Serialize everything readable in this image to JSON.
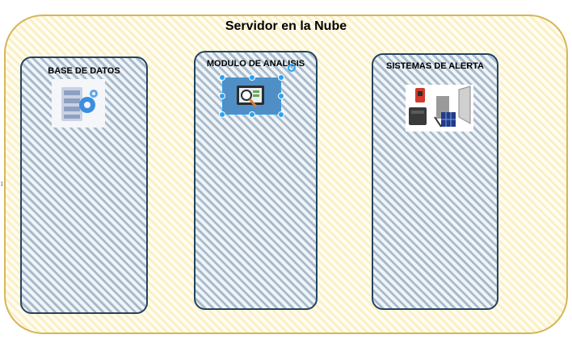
{
  "diagram": {
    "title": "Servidor en la Nube",
    "boxes": [
      {
        "id": "db",
        "label": "BASE DE DATOS",
        "icon": "database-server-icon"
      },
      {
        "id": "analysis",
        "label": "MODULO DE ANALISIS",
        "icon": "analysis-monitor-icon"
      },
      {
        "id": "alerts",
        "label": "SISTEMAS DE ALERTA",
        "icon": "alert-devices-icon"
      }
    ]
  },
  "colors": {
    "outer_border": "#d6b656",
    "outer_fill": "#fff2cc",
    "box_border": "#23445d",
    "box_fill": "#bac8d3",
    "selection": "#29a3f3"
  }
}
